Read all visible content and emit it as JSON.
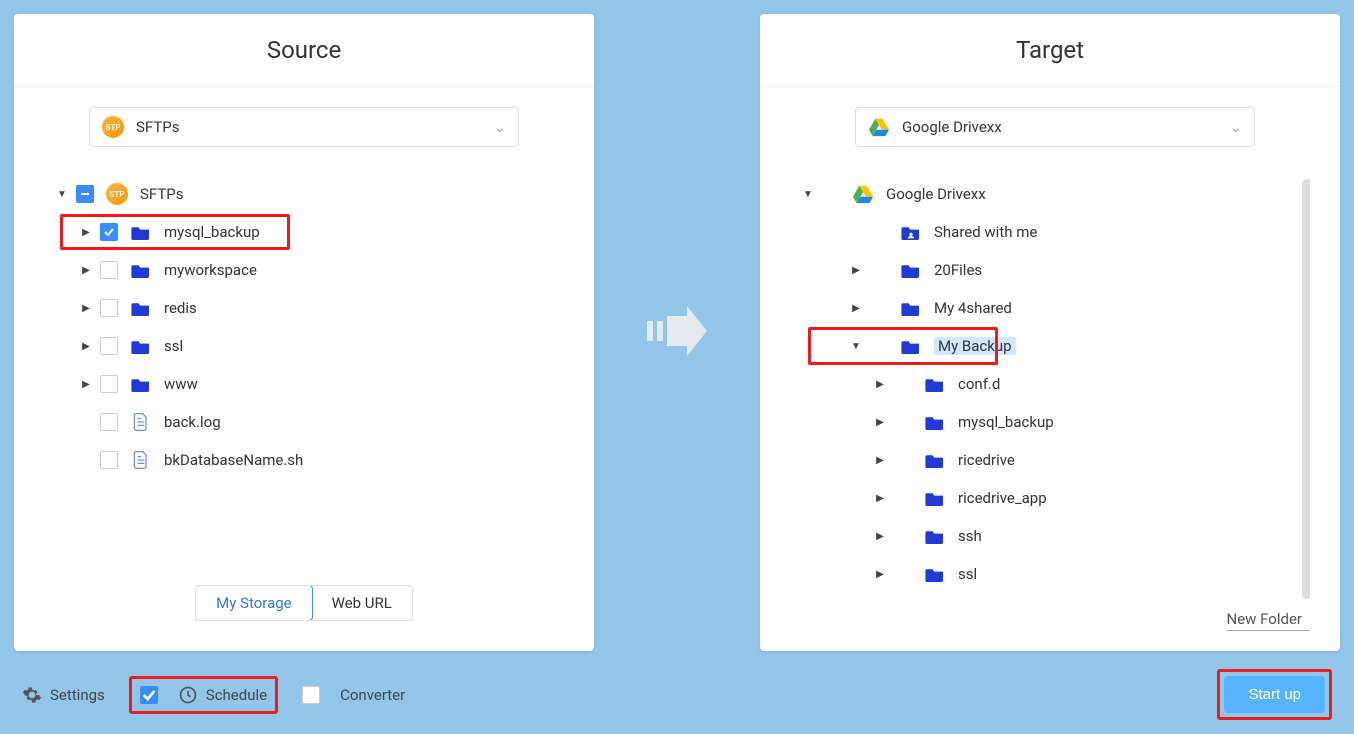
{
  "source": {
    "title": "Source",
    "dropdown": "SFTPs",
    "root_label": "SFTPs",
    "items": [
      {
        "label": "mysql_backup",
        "checked": true,
        "type": "folder",
        "highlight": true,
        "caret": "r"
      },
      {
        "label": "myworkspace",
        "checked": false,
        "type": "folder",
        "caret": "r"
      },
      {
        "label": "redis",
        "checked": false,
        "type": "folder",
        "caret": "r"
      },
      {
        "label": "ssl",
        "checked": false,
        "type": "folder",
        "caret": "r"
      },
      {
        "label": "www",
        "checked": false,
        "type": "folder",
        "caret": "r"
      },
      {
        "label": "back.log",
        "checked": false,
        "type": "file",
        "caret": ""
      },
      {
        "label": "bkDatabaseName.sh",
        "checked": false,
        "type": "file",
        "caret": ""
      }
    ],
    "tabs": {
      "active": "My Storage",
      "inactive": "Web URL"
    }
  },
  "target": {
    "title": "Target",
    "dropdown": "Google Drivexx",
    "root_label": "Google Drivexx",
    "new_folder": "New Folder",
    "items": [
      {
        "label": "Shared with me",
        "type": "shared",
        "indent": 3,
        "caret": ""
      },
      {
        "label": "20Files",
        "type": "folder",
        "indent": 3,
        "caret": "r"
      },
      {
        "label": "My 4shared",
        "type": "folder",
        "indent": 3,
        "caret": "r"
      },
      {
        "label": "My Backup",
        "type": "folder",
        "indent": 3,
        "caret": "d",
        "highlight": true,
        "selected": true
      },
      {
        "label": "conf.d",
        "type": "folder",
        "indent": 4,
        "caret": "r"
      },
      {
        "label": "mysql_backup",
        "type": "folder",
        "indent": 4,
        "caret": "r"
      },
      {
        "label": "ricedrive",
        "type": "folder",
        "indent": 4,
        "caret": "r"
      },
      {
        "label": "ricedrive_app",
        "type": "folder",
        "indent": 4,
        "caret": "r"
      },
      {
        "label": "ssh",
        "type": "folder",
        "indent": 4,
        "caret": "r"
      },
      {
        "label": "ssl",
        "type": "folder",
        "indent": 4,
        "caret": "r"
      }
    ]
  },
  "bottom": {
    "settings": "Settings",
    "schedule": "Schedule",
    "converter": "Converter",
    "startup": "Start up"
  }
}
